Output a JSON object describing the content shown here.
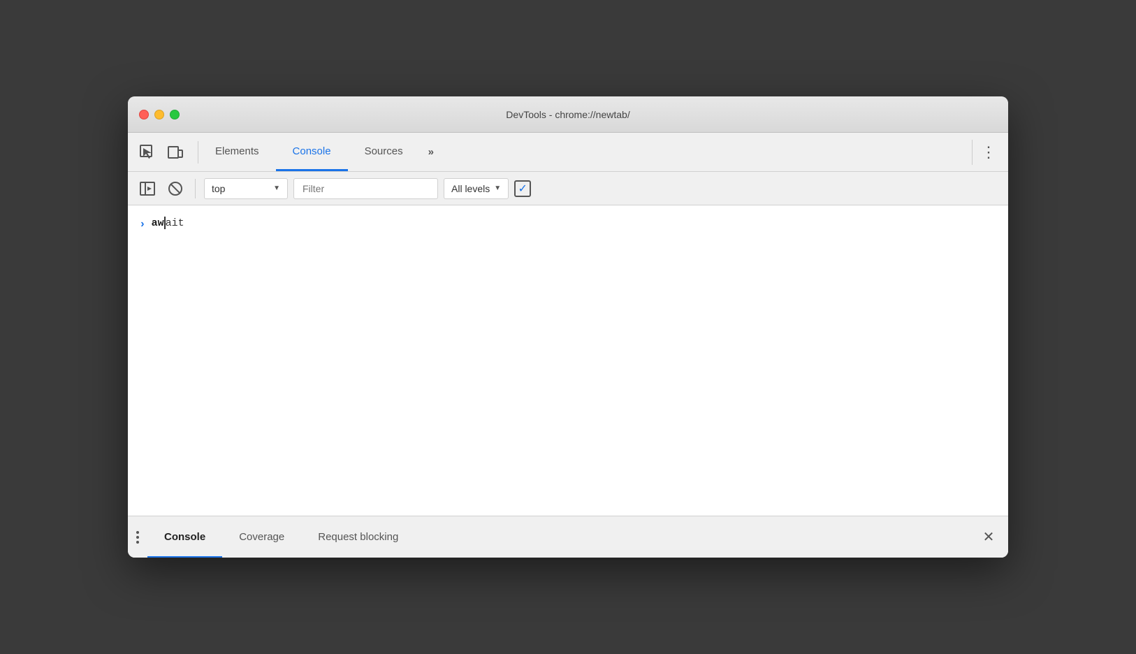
{
  "window": {
    "title": "DevTools - chrome://newtab/"
  },
  "toolbar": {
    "tabs": [
      {
        "id": "elements",
        "label": "Elements",
        "active": false
      },
      {
        "id": "console",
        "label": "Console",
        "active": true
      },
      {
        "id": "sources",
        "label": "Sources",
        "active": false
      }
    ],
    "more_label": "»",
    "menu_label": "⋮"
  },
  "console_toolbar": {
    "context_value": "top",
    "filter_placeholder": "Filter",
    "levels_label": "All levels"
  },
  "console": {
    "entry": {
      "arrow": "›",
      "text_bold": "aw",
      "text_normal": "ait"
    }
  },
  "bottom_panel": {
    "tabs": [
      {
        "id": "console",
        "label": "Console",
        "active": true
      },
      {
        "id": "coverage",
        "label": "Coverage",
        "active": false
      },
      {
        "id": "request-blocking",
        "label": "Request blocking",
        "active": false
      }
    ],
    "close_label": "✕"
  }
}
